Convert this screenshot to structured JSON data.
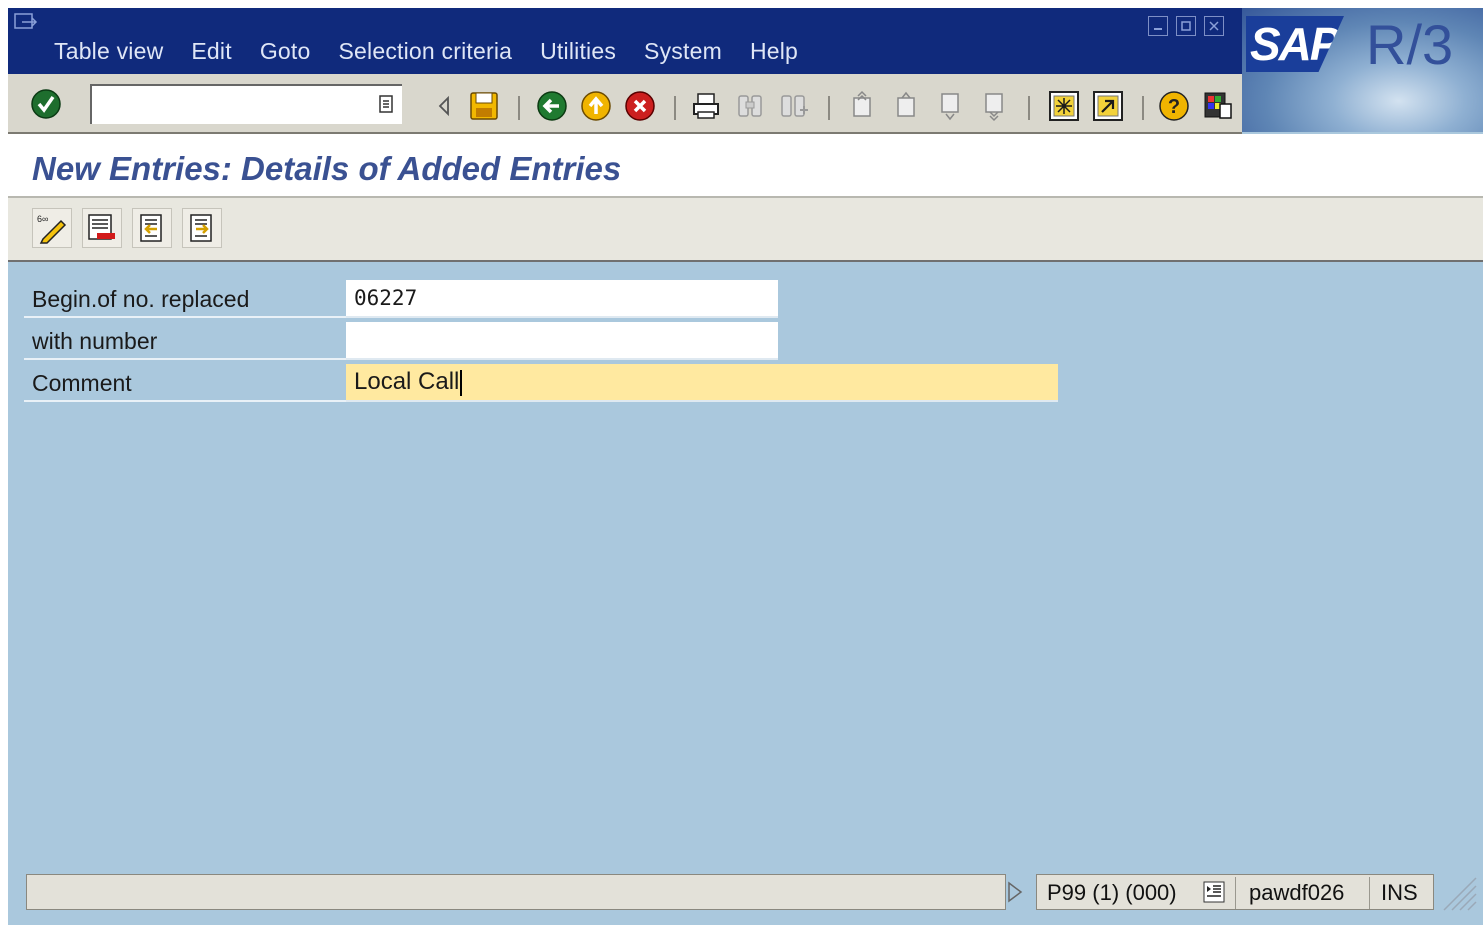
{
  "menubar": {
    "items": [
      {
        "label": "Table view"
      },
      {
        "label": "Edit"
      },
      {
        "label": "Goto"
      },
      {
        "label": "Selection criteria"
      },
      {
        "label": "Utilities"
      },
      {
        "label": "System"
      },
      {
        "label": "Help"
      }
    ]
  },
  "brand": {
    "logo": "SAP",
    "product": "R/3"
  },
  "toolbar": {
    "command_value": "",
    "icons": [
      "enter-icon",
      "back-arrow-icon",
      "save-icon",
      "back-icon",
      "exit-icon",
      "cancel-icon",
      "print-icon",
      "find-icon",
      "find-next-icon",
      "first-page-icon",
      "previous-page-icon",
      "next-page-icon",
      "last-page-icon",
      "create-session-icon",
      "create-shortcut-icon",
      "help-icon",
      "customize-layout-icon"
    ]
  },
  "title": "New Entries: Details of Added Entries",
  "app_toolbar": {
    "icons": [
      "change-display-icon",
      "delete-icon",
      "previous-entry-icon",
      "next-entry-icon"
    ]
  },
  "form": {
    "fields": [
      {
        "label": "Begin.of no. replaced",
        "value": "06227"
      },
      {
        "label": "with number",
        "value": ""
      },
      {
        "label": "Comment",
        "value": "Local Call"
      }
    ]
  },
  "statusbar": {
    "system": "P99 (1) (000)",
    "server": "pawdf026",
    "mode": "INS"
  },
  "colors": {
    "menubar_bg": "#102a7c",
    "workspace_bg": "#aac8dd",
    "title_text": "#3a5192",
    "active_field": "#ffe9a0"
  }
}
